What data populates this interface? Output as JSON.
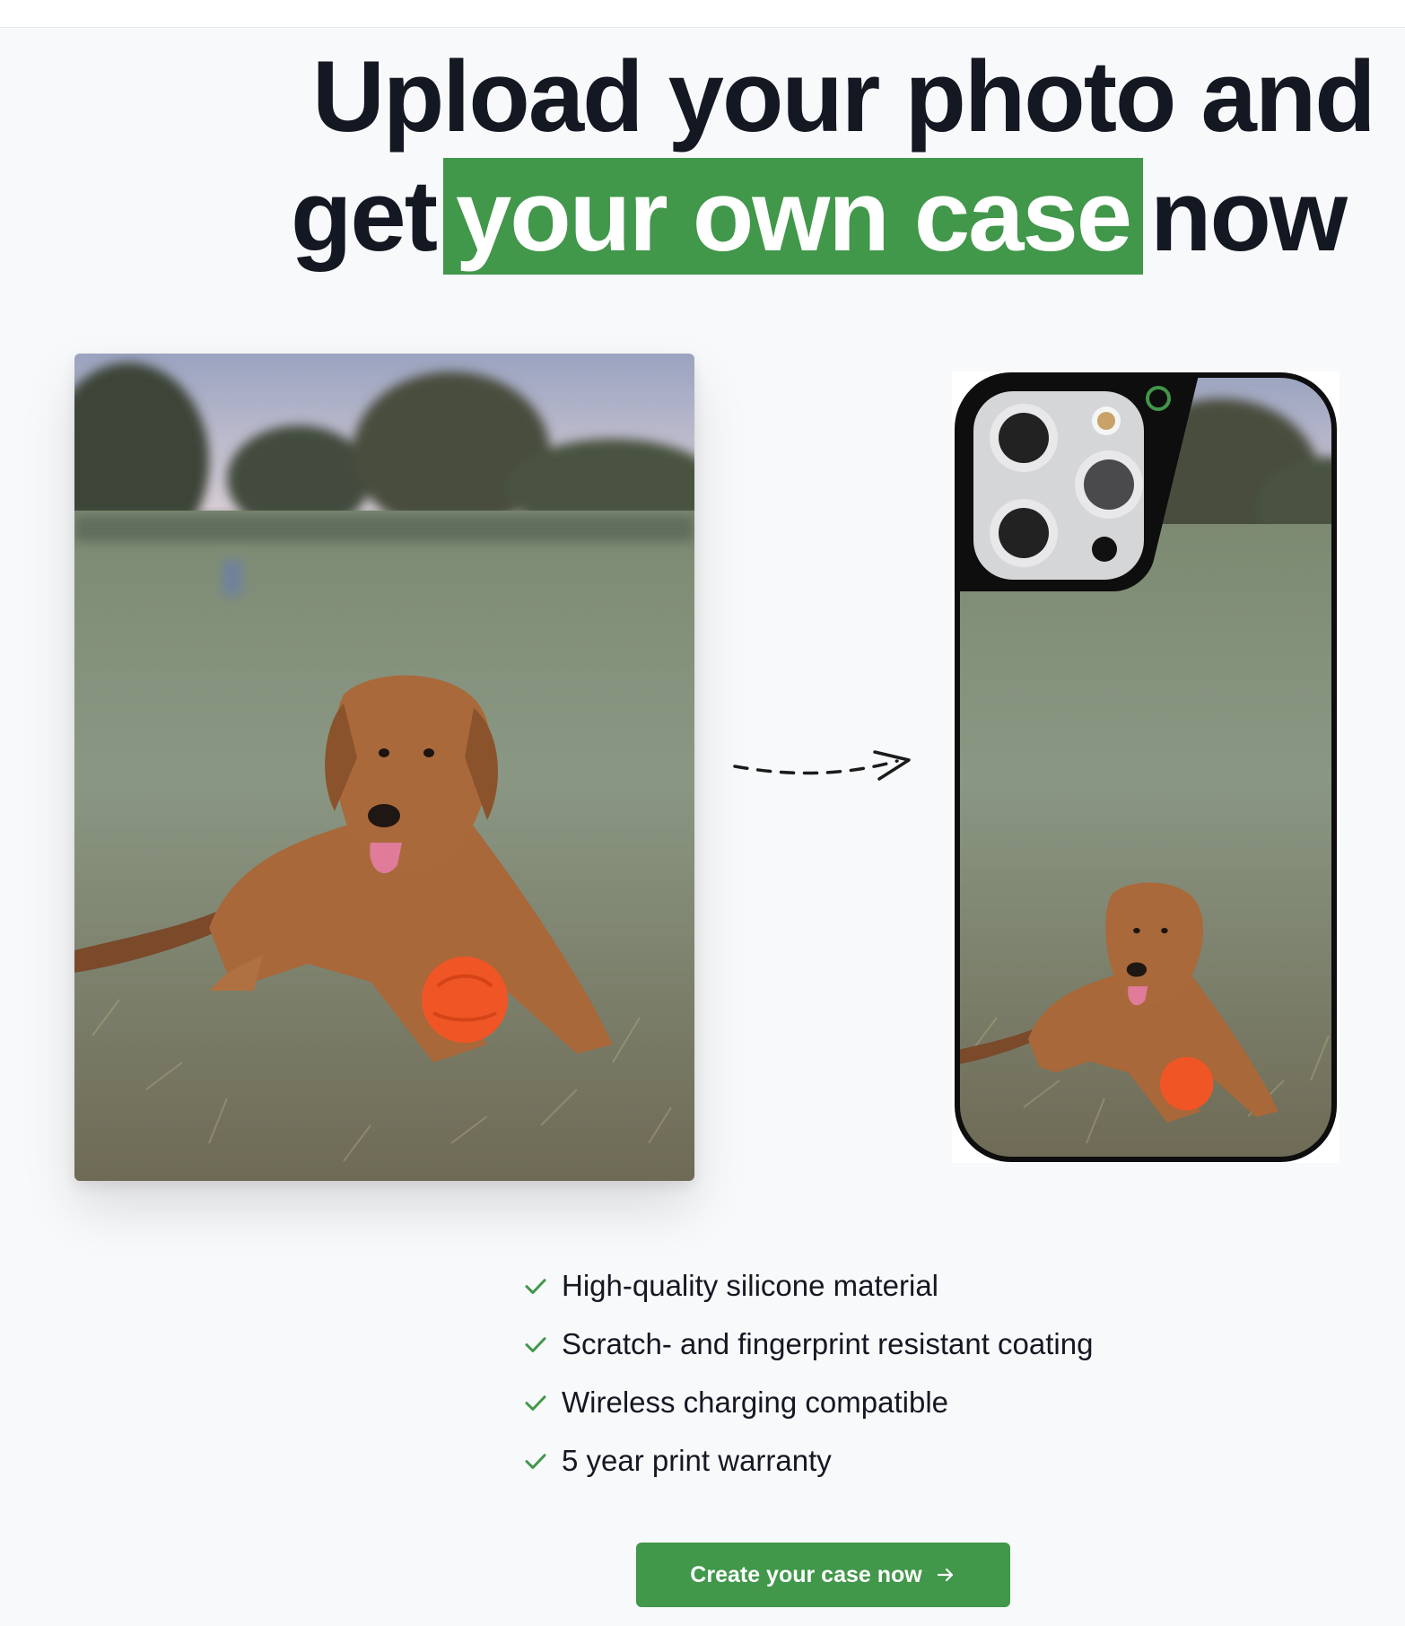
{
  "headline": {
    "line1": "Upload your photo and",
    "line2_prefix": "get",
    "line2_highlight": "your own case",
    "line2_suffix": "now"
  },
  "features": [
    "High-quality silicone material",
    "Scratch- and fingerprint resistant coating",
    "Wireless charging compatible",
    "5 year print warranty"
  ],
  "cta": {
    "label": "Create your case now"
  },
  "colors": {
    "accent": "#41974a",
    "text": "#141822",
    "background": "#f8f9fb"
  },
  "icons": {
    "feature": "check-icon",
    "cta": "arrow-right-icon",
    "between": "dashed-arrow-icon"
  }
}
